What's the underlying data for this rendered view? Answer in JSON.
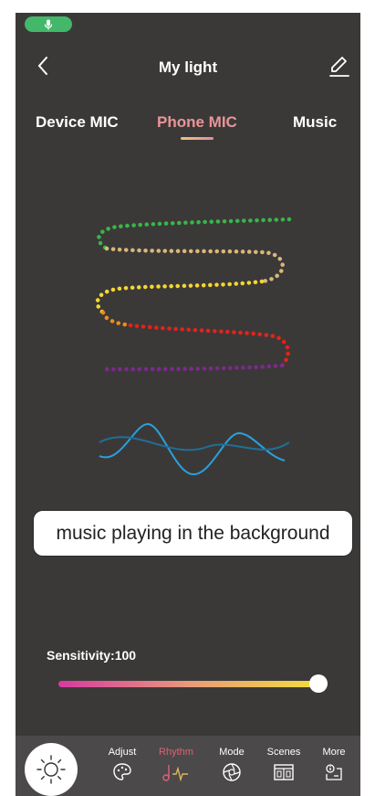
{
  "header": {
    "title": "My light"
  },
  "tabs": [
    {
      "label": "Device MIC"
    },
    {
      "label": "Phone MIC",
      "active": true
    },
    {
      "label": "Music"
    }
  ],
  "banner": {
    "text": "music playing in the background"
  },
  "sensitivity": {
    "label": "Sensitivity:100",
    "value": 100
  },
  "nav": {
    "items": [
      {
        "label": "Adjust",
        "icon": "palette-icon"
      },
      {
        "label": "Rhythm",
        "icon": "music-note-icon",
        "active": true
      },
      {
        "label": "Mode",
        "icon": "mode-icon"
      },
      {
        "label": "Scenes",
        "icon": "scenes-icon"
      },
      {
        "label": "More",
        "icon": "more-icon"
      }
    ]
  },
  "colors": {
    "background": "#3b3938",
    "mic_indicator": "#43b86a",
    "active_tab": "#e99598",
    "strip_green": "#39b54a",
    "strip_tan": "#d9b77a",
    "strip_yellow": "#f4d631",
    "strip_orange": "#f08a1c",
    "strip_red": "#e2231a",
    "strip_purple": "#7b2a8c",
    "wave_blue": "#2aa1dc"
  }
}
